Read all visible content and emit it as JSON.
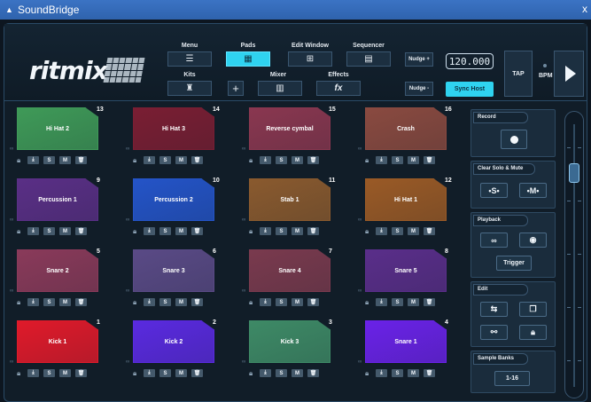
{
  "window": {
    "title": "SoundBridge",
    "close": "x"
  },
  "brand": {
    "name": "ritmix"
  },
  "toolbar": {
    "menu_label": "Menu",
    "pads_label": "Pads",
    "edit_window_label": "Edit Window",
    "sequencer_label": "Sequencer",
    "kits_label": "Kits",
    "mixer_label": "Mixer",
    "effects_label": "Effects",
    "add_symbol": "+",
    "nudge_plus": "Nudge +",
    "nudge_minus": "Nudge -",
    "bpm_value": "120.000",
    "sync_host": "Sync Host",
    "tap": "TAP",
    "bpm_label": "BPM",
    "active_tab": "Pads"
  },
  "pads": [
    {
      "num": "13",
      "name": "Hi Hat 2",
      "color": "#3f9a58"
    },
    {
      "num": "14",
      "name": "Hi Hat 3",
      "color": "#7a1e33"
    },
    {
      "num": "15",
      "name": "Reverse cymbal",
      "color": "#8a3750"
    },
    {
      "num": "16",
      "name": "Crash",
      "color": "#8a4a40"
    },
    {
      "num": "9",
      "name": "Percussion 1",
      "color": "#5a2f86"
    },
    {
      "num": "10",
      "name": "Percussion 2",
      "color": "#2454c8"
    },
    {
      "num": "11",
      "name": "Stab 1",
      "color": "#8a5a2e"
    },
    {
      "num": "12",
      "name": "Hi Hat 1",
      "color": "#9a5a26"
    },
    {
      "num": "5",
      "name": "Snare 2",
      "color": "#8a3a5a"
    },
    {
      "num": "6",
      "name": "Snare 3",
      "color": "#5a4a86"
    },
    {
      "num": "7",
      "name": "Snare 4",
      "color": "#7a3a4e"
    },
    {
      "num": "8",
      "name": "Snare 5",
      "color": "#5a2e8a"
    },
    {
      "num": "1",
      "name": "Kick 1",
      "color": "#e01a2a"
    },
    {
      "num": "2",
      "name": "Kick 2",
      "color": "#5a2ae0"
    },
    {
      "num": "3",
      "name": "Kick 3",
      "color": "#3e8a66"
    },
    {
      "num": "4",
      "name": "Snare 1",
      "color": "#6a22e8"
    }
  ],
  "pad_controls": {
    "solo": "S",
    "mute": "M"
  },
  "side": {
    "record_title": "Record",
    "clear_title": "Clear Solo & Mute",
    "clear_solo": "•S•",
    "clear_mute": "•M•",
    "playback_title": "Playback",
    "trigger": "Trigger",
    "edit_title": "Edit",
    "banks_title": "Sample Banks",
    "bank_value": "1-16"
  }
}
